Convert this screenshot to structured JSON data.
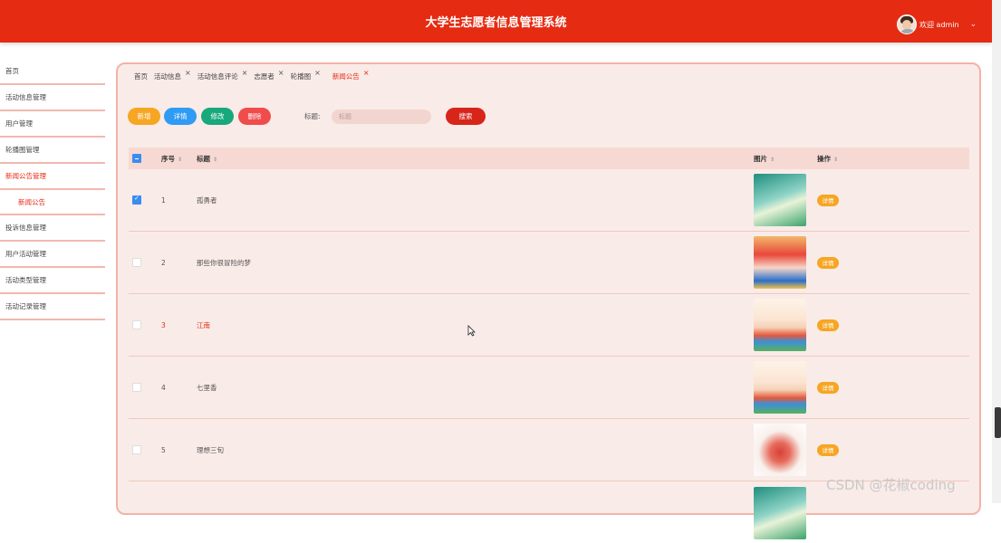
{
  "app": {
    "title": "大学生志愿者信息管理系统"
  },
  "user": {
    "welcome": "欢迎 admin"
  },
  "sidebar": {
    "items": [
      {
        "label": "首页"
      },
      {
        "label": "活动信息管理"
      },
      {
        "label": "用户管理"
      },
      {
        "label": "轮播图管理"
      },
      {
        "label": "新闻公告管理"
      },
      {
        "label": "投诉信息管理"
      },
      {
        "label": "用户活动管理"
      },
      {
        "label": "活动类型管理"
      },
      {
        "label": "活动记录管理"
      }
    ],
    "subitem": "新闻公告"
  },
  "tabs": [
    {
      "label": "首页"
    },
    {
      "label": "活动信息",
      "close": "×"
    },
    {
      "label": "活动信息评论",
      "close": "×"
    },
    {
      "label": "志愿者",
      "close": "×"
    },
    {
      "label": "轮播图",
      "close": "×"
    },
    {
      "label": "新闻公告",
      "close": "×"
    }
  ],
  "toolbar": {
    "add": "新增",
    "detail": "详情",
    "edit": "修改",
    "delete": "删除",
    "search_label": "标题:",
    "search_placeholder": "标题",
    "search_button": "搜索"
  },
  "table": {
    "headers": {
      "no": "序号",
      "title": "标题",
      "image": "图片",
      "op": "操作"
    },
    "rows": [
      {
        "no": "1",
        "title": "孤勇者",
        "op": "详情",
        "checked": true
      },
      {
        "no": "2",
        "title": "那些你很冒险的梦",
        "op": "详情",
        "checked": false
      },
      {
        "no": "3",
        "title": "江南",
        "op": "详情",
        "checked": false
      },
      {
        "no": "4",
        "title": "七里香",
        "op": "详情",
        "checked": false
      },
      {
        "no": "5",
        "title": "理想三旬",
        "op": "详情",
        "checked": false
      }
    ]
  },
  "watermark": "CSDN @花椒coding"
}
